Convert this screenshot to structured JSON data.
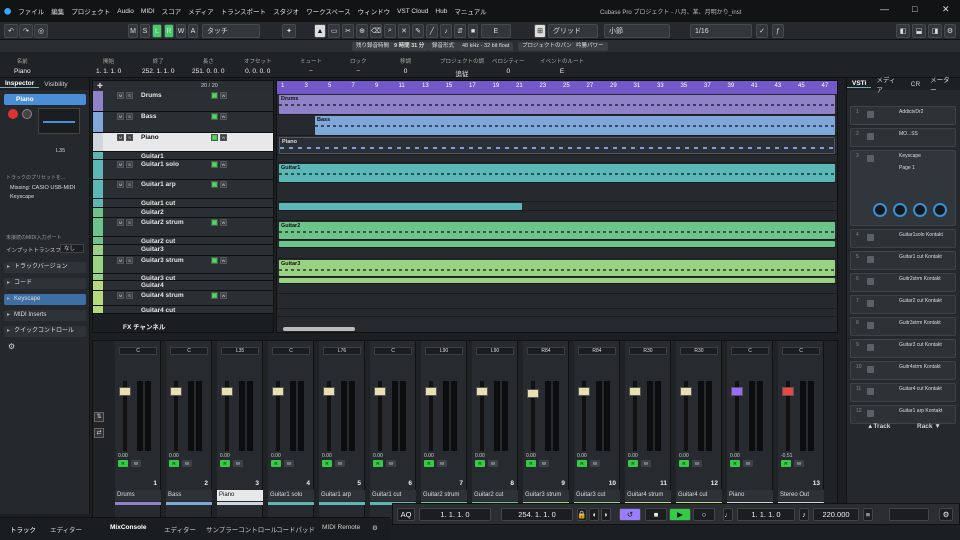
{
  "window": {
    "title": "Cubase Pro プロジェクト - 八月、某、月明かり_inst",
    "min": "—",
    "max": "□",
    "close": "✕"
  },
  "menu": [
    "ファイル",
    "編集",
    "プロジェクト",
    "Audio",
    "MIDI",
    "スコア",
    "メディア",
    "トランスポート",
    "スタジオ",
    "ワークスペース",
    "ウィンドウ",
    "VST Cloud",
    "Hub",
    "マニュアル"
  ],
  "toolbar": {
    "m": "M",
    "s": "S",
    "l": "L",
    "r": "R",
    "w": "W",
    "a": "A",
    "touch": "タッチ",
    "grid": "グリッド",
    "bar": "小節",
    "quant": "1/16",
    "snap_e": "E"
  },
  "info": {
    "max_rec_label": "残り録音時間",
    "max_rec": "9 時間 31 分",
    "format_label": "録音形式",
    "format": "48 kHz - 32 bit float",
    "pan_label": "プロジェクトのパン補正",
    "pan_val": "吟勝パワー"
  },
  "eventline": [
    {
      "label": "名前",
      "value": "Piano"
    },
    {
      "label": "開始",
      "value": "1. 1. 1.  0"
    },
    {
      "label": "終了",
      "value": "252. 1. 1.  0"
    },
    {
      "label": "長さ",
      "value": "251. 0. 0.  0"
    },
    {
      "label": "オフセット",
      "value": "0. 0. 0.  0"
    },
    {
      "label": "ミュート",
      "value": "−"
    },
    {
      "label": "ロック",
      "value": "−"
    },
    {
      "label": "移調",
      "value": "0"
    },
    {
      "label": "プロジェクトの調",
      "value": "追従"
    },
    {
      "label": "ベロシティー",
      "value": "0"
    },
    {
      "label": "イベントのルート",
      "value": "E"
    }
  ],
  "inspector": {
    "tabs": [
      "Inspector",
      "Visibility"
    ],
    "track_name": "Piano",
    "l_value": "L35",
    "input": "Missing: CASIO USB-MIDI",
    "output": "Keyscape",
    "transpose_label": "インプットトランスフォーマー",
    "transpose_val": "なし",
    "sections": [
      "トラックバージョン",
      "コード",
      "Keyscape",
      "MIDI Inserts",
      "クイックコントロール"
    ],
    "note1": "トラックのプリセットを...",
    "note2": "未接続のMIDI入力ポート"
  },
  "tracklist": {
    "count": "20 / 20",
    "fx": "FX チャンネル"
  },
  "tracks": [
    {
      "name": "Drums",
      "color": "#8f82c9"
    },
    {
      "name": "Bass",
      "color": "#7fa7d9"
    },
    {
      "name": "Piano",
      "color": "#cfd6de"
    },
    {
      "name": "Guitar1",
      "color": "#5bb8b6"
    },
    {
      "name": "Guitar1 solo",
      "color": "#5bb8b6"
    },
    {
      "name": "Guitar1 arp",
      "color": "#5bb8b6"
    },
    {
      "name": "Guitar1 cut",
      "color": "#5bb8b6"
    },
    {
      "name": "Guitar2",
      "color": "#6cc48a"
    },
    {
      "name": "Guitar2 strum",
      "color": "#6cc48a"
    },
    {
      "name": "Guitar2 cut",
      "color": "#6cc48a"
    },
    {
      "name": "Guitar3",
      "color": "#9ad283"
    },
    {
      "name": "Guitar3 strum",
      "color": "#9ad283"
    },
    {
      "name": "Guitar3 cut",
      "color": "#9ad283"
    },
    {
      "name": "Guitar4",
      "color": "#b6d97b"
    },
    {
      "name": "Guitar4 strum",
      "color": "#b6d97b"
    },
    {
      "name": "Guitar4 cut",
      "color": "#b6d97b"
    }
  ],
  "ruler": [
    "1",
    "3",
    "5",
    "7",
    "9",
    "11",
    "13",
    "15",
    "17",
    "19",
    "21",
    "23",
    "25",
    "27",
    "29",
    "31",
    "33",
    "35",
    "37",
    "39",
    "41",
    "43",
    "45",
    "47"
  ],
  "mixer_channels": [
    {
      "name": "Drums",
      "num": "1",
      "pan": "C",
      "val": "0.00",
      "color": "#8f82c9"
    },
    {
      "name": "Bass",
      "num": "2",
      "pan": "C",
      "val": "0.00",
      "color": "#7fa7d9"
    },
    {
      "name": "Piano",
      "num": "3",
      "pan": "L35",
      "val": "0.00",
      "color": "#cfd6de"
    },
    {
      "name": "Guitar1 solo",
      "num": "4",
      "pan": "C",
      "val": "0.00",
      "color": "#5bb8b6"
    },
    {
      "name": "Guitar1 arp",
      "num": "5",
      "pan": "L76",
      "val": "0.00",
      "color": "#5bb8b6"
    },
    {
      "name": "Guitar1 cut",
      "num": "6",
      "pan": "C",
      "val": "0.00",
      "color": "#5bb8b6"
    },
    {
      "name": "Guitar2 strum",
      "num": "7",
      "pan": "L90",
      "val": "0.00",
      "color": "#6cc48a"
    },
    {
      "name": "Guitar2 cut",
      "num": "8",
      "pan": "L90",
      "val": "0.00",
      "color": "#6cc48a"
    },
    {
      "name": "Guitar3 strum",
      "num": "9",
      "pan": "R84",
      "val": "0.00",
      "color": "#9ad283"
    },
    {
      "name": "Guitar3 cut",
      "num": "10",
      "pan": "R84",
      "val": "0.00",
      "color": "#9ad283"
    },
    {
      "name": "Guitar4 strum",
      "num": "11",
      "pan": "R30",
      "val": "0.00",
      "color": "#b6d97b"
    },
    {
      "name": "Guitar4 cut",
      "num": "12",
      "pan": "R30",
      "val": "0.00",
      "color": "#b6d97b"
    },
    {
      "name": "Piano",
      "num": "",
      "pan": "C",
      "val": "0.00",
      "color": "#cfd6de"
    },
    {
      "name": "Stereo Out",
      "num": "13",
      "pan": "C",
      "val": "-0.51",
      "color": "#cfd6de"
    }
  ],
  "vsti": {
    "tabs": [
      "VSTi",
      "メディア",
      "CR",
      "メーター"
    ],
    "slots": [
      {
        "n": "1",
        "p": "AddictvDr2"
      },
      {
        "n": "2",
        "p": "MO...SS"
      },
      {
        "n": "3",
        "p": "Keyscape",
        "sub": "Page 1"
      },
      {
        "n": "4",
        "p": "Guitar1solo Kontakt"
      },
      {
        "n": "5",
        "p": "Guitar1 cut Kontakt"
      },
      {
        "n": "6",
        "p": "Guitr2strm Kontakt"
      },
      {
        "n": "7",
        "p": "Guitar2 cut Kontakt"
      },
      {
        "n": "8",
        "p": "Guitr3strm Kontakt"
      },
      {
        "n": "9",
        "p": "Guitar3 cut Kontakt"
      },
      {
        "n": "10",
        "p": "Guitr4strm Kontakt"
      },
      {
        "n": "11",
        "p": "Guitar4 cut Kontakt"
      },
      {
        "n": "12",
        "p": "Guitar1 arp Kontakt"
      }
    ],
    "track_label": "▲Track",
    "rack_label": "Rack ▼"
  },
  "bottom_tabs": [
    "トラック",
    "エディター",
    "MixConsole",
    "エディター",
    "サンプラーコントロール",
    "コードパッド",
    "MIDI Remote"
  ],
  "transport": {
    "left": "1. 1. 1.  0",
    "right": "254. 1. 1.  0",
    "pos": "1. 1. 1.  0",
    "tempo": "220.000",
    "aq": "AQ"
  }
}
